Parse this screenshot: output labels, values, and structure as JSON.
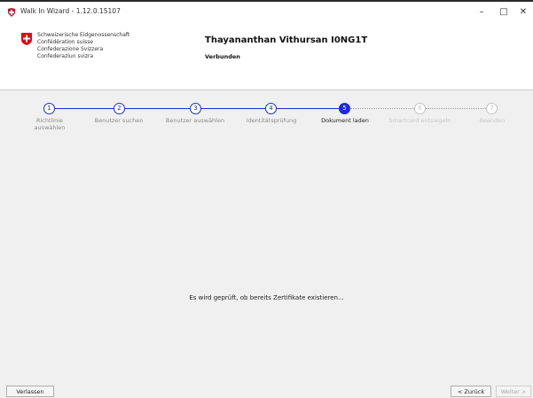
{
  "window": {
    "title": "Walk In Wizard - 1.12.0.15107",
    "controls": {
      "minimize": "–",
      "maximize": "□",
      "close": "✕"
    }
  },
  "header": {
    "confederation": [
      "Schweizerische Eidgenossenschaft",
      "Confédération suisse",
      "Confederazione Svizzera",
      "Confederaziun svizra"
    ],
    "user_name": "Thayananthan Vithursan I0NG1T",
    "status": "Verbunden"
  },
  "stepper": {
    "steps": [
      {
        "number": "1",
        "label": "Richtlinie\nauswählen",
        "state": "done"
      },
      {
        "number": "2",
        "label": "Benutzer suchen",
        "state": "done"
      },
      {
        "number": "3",
        "label": "Benutzer auswählen",
        "state": "done"
      },
      {
        "number": "4",
        "label": "Identitätsprüfung",
        "state": "done"
      },
      {
        "number": "5",
        "label": "Dokument laden",
        "state": "active"
      },
      {
        "number": "6",
        "label": "Smartcard entsiegeln",
        "state": "future"
      },
      {
        "number": "7",
        "label": "Beenden",
        "state": "future"
      }
    ]
  },
  "main": {
    "status_message": "Es wird geprüft, ob bereits Zertifikate existieren..."
  },
  "footer": {
    "leave_label": "Verlassen",
    "back_label": "< Zurück",
    "next_label": "Weiter >"
  },
  "colors": {
    "accent": "#1f2bd6",
    "swiss_red": "#e30613",
    "disabled": "#c4c4c4"
  }
}
